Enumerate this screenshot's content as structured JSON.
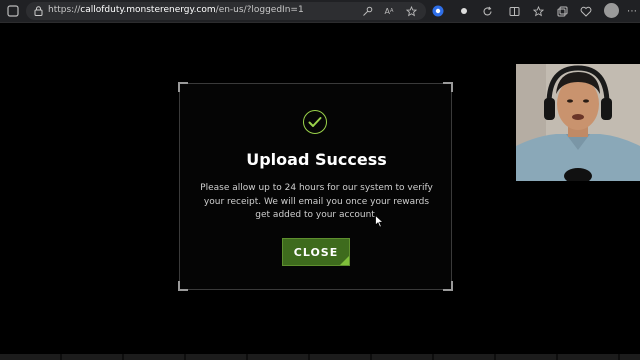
{
  "browser": {
    "url_prefix": "https://",
    "url_domain": "callofduty.monsterenergy.com",
    "url_path": "/en-us/?loggedIn=1"
  },
  "modal": {
    "title": "Upload Success",
    "message": "Please allow up to 24 hours for our system to verify your receipt. We will email you once your rewards get added to your account.",
    "close_label": "CLOSE",
    "accent_color": "#9ad24a",
    "button_color": "#3e6b1d"
  },
  "icons": {
    "check": "check-circle-icon",
    "lock": "lock-icon",
    "cursor": "mouse-cursor-icon"
  }
}
